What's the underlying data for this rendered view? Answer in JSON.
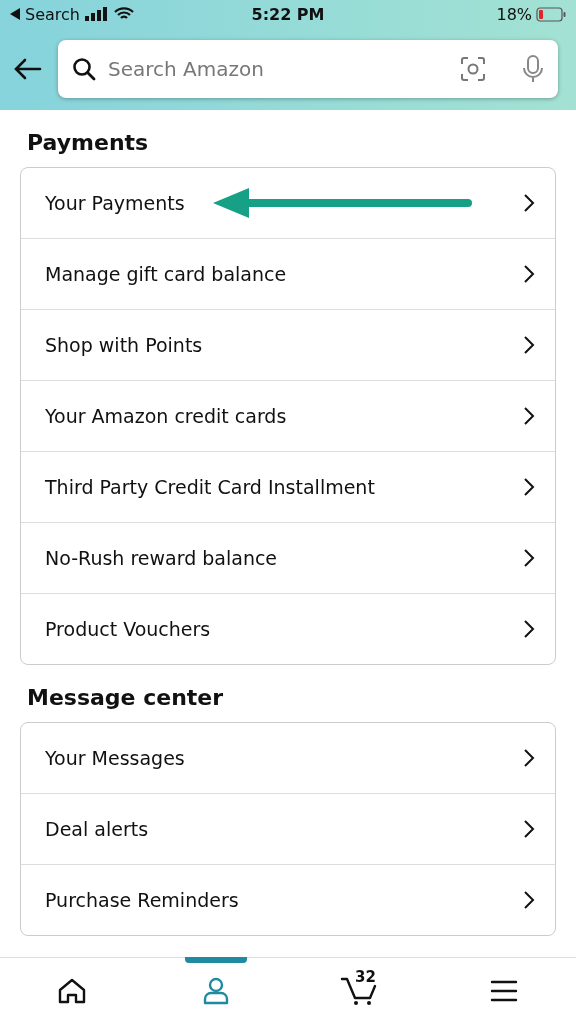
{
  "status_bar": {
    "back_label": "Search",
    "time": "5:22 PM",
    "battery": "18%"
  },
  "search": {
    "placeholder": "Search Amazon"
  },
  "sections": [
    {
      "title": "Payments",
      "items": [
        {
          "label": "Your Payments",
          "annotated": true
        },
        {
          "label": "Manage gift card balance",
          "annotated": false
        },
        {
          "label": "Shop with Points",
          "annotated": false
        },
        {
          "label": "Your Amazon credit cards",
          "annotated": false
        },
        {
          "label": "Third Party Credit Card Installment",
          "annotated": false
        },
        {
          "label": "No-Rush reward balance",
          "annotated": false
        },
        {
          "label": "Product Vouchers",
          "annotated": false
        }
      ]
    },
    {
      "title": "Message center",
      "items": [
        {
          "label": "Your Messages",
          "annotated": false
        },
        {
          "label": "Deal alerts",
          "annotated": false
        },
        {
          "label": "Purchase Reminders",
          "annotated": false
        }
      ]
    }
  ],
  "tab_bar": [
    {
      "kind": "home",
      "selected": false
    },
    {
      "kind": "account",
      "selected": true
    },
    {
      "kind": "cart",
      "selected": false,
      "badge": "32"
    },
    {
      "kind": "menu",
      "selected": false
    }
  ]
}
